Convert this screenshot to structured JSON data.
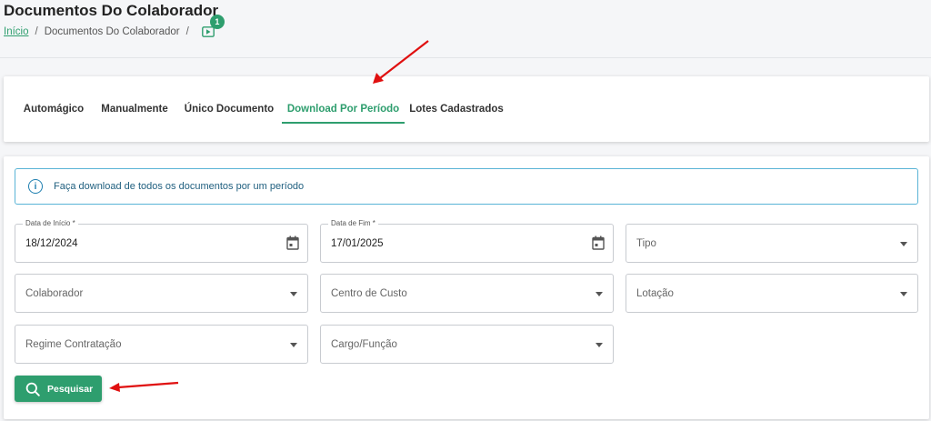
{
  "page": {
    "title": "Documentos Do Colaborador"
  },
  "breadcrumb": {
    "home": "Início",
    "separator": "/",
    "current": "Documentos Do Colaborador",
    "badge_count": "1"
  },
  "tabs": [
    {
      "label": "Automágico"
    },
    {
      "label": "Manualmente"
    },
    {
      "label": "Único Documento"
    },
    {
      "label": "Download Por Período",
      "active": true
    },
    {
      "label": "Lotes Cadastrados"
    }
  ],
  "alert": {
    "text": "Faça download de todos os documentos por um período"
  },
  "fields": {
    "data_inicio": {
      "label": "Data de Início *",
      "value": "18/12/2024"
    },
    "data_fim": {
      "label": "Data de Fim *",
      "value": "17/01/2025"
    },
    "tipo": {
      "placeholder": "Tipo"
    },
    "colaborador": {
      "placeholder": "Colaborador"
    },
    "centro_custo": {
      "placeholder": "Centro de Custo"
    },
    "lotacao": {
      "placeholder": "Lotação"
    },
    "regime": {
      "placeholder": "Regime Contratação"
    },
    "cargo": {
      "placeholder": "Cargo/Função"
    }
  },
  "search_button": {
    "label": "Pesquisar"
  },
  "colors": {
    "accent": "#2e9e6e",
    "annotation": "#e01010",
    "info": "#1f7fb0"
  }
}
